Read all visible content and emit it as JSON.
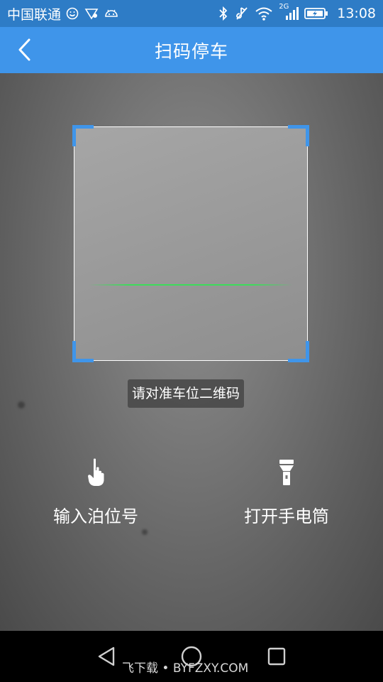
{
  "status_bar": {
    "carrier": "中国联通",
    "network_type": "2G",
    "time": "13:08",
    "icons": [
      "smiley-icon",
      "notification-icon",
      "android-icon",
      "bluetooth-icon",
      "mute-icon",
      "wifi-icon",
      "signal-icon",
      "battery-icon"
    ]
  },
  "header": {
    "title": "扫码停车",
    "back_icon": "chevron-left-icon"
  },
  "scanner": {
    "hint": "请对准车位二维码",
    "frame_color": "#3f95ea",
    "scan_line_color": "#3ddc5a"
  },
  "actions": [
    {
      "label": "输入泊位号",
      "icon": "hand-pointer-icon"
    },
    {
      "label": "打开手电筒",
      "icon": "flashlight-icon"
    }
  ],
  "nav_bar": {
    "buttons": [
      "back-triangle-icon",
      "home-circle-icon",
      "recents-square-icon"
    ],
    "watermark": "飞下载 • BYFZXY.COM"
  },
  "colors": {
    "status_bar": "#2e7cc6",
    "title_bar": "#3f95ea"
  }
}
